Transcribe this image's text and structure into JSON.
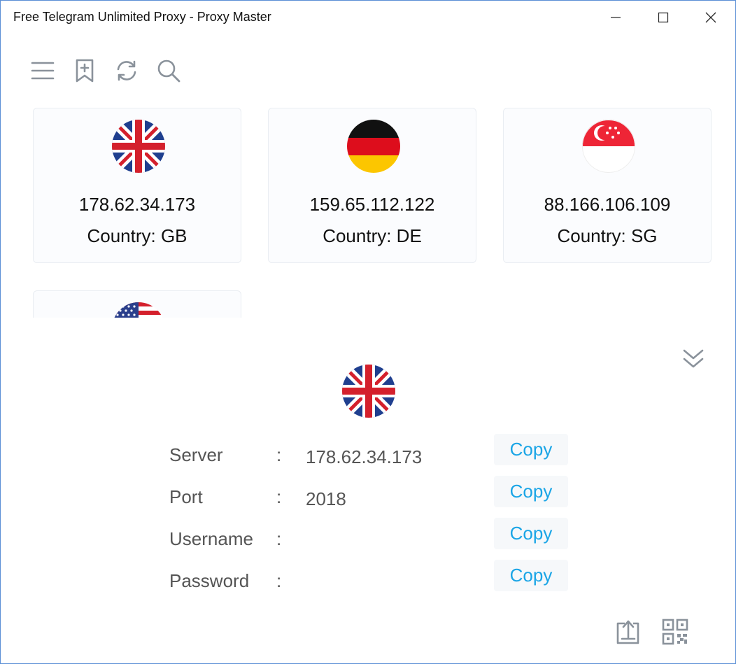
{
  "window": {
    "title": "Free Telegram Unlimited Proxy - Proxy Master"
  },
  "toolbar": {
    "icons": [
      "menu-icon",
      "bookmark-add-icon",
      "refresh-icon",
      "search-icon"
    ]
  },
  "proxies": [
    {
      "ip": "178.62.34.173",
      "country": "Country: GB",
      "flag": "gb-flag-icon"
    },
    {
      "ip": "159.65.112.122",
      "country": "Country: DE",
      "flag": "de-flag-icon"
    },
    {
      "ip": "88.166.106.109",
      "country": "Country: SG",
      "flag": "sg-flag-icon"
    },
    {
      "ip": "",
      "country": "",
      "flag": "us-flag-icon"
    }
  ],
  "detail": {
    "flag": "gb-flag-icon",
    "rows": [
      {
        "label": "Server",
        "colon": ":",
        "value": "178.62.34.173",
        "copy": "Copy"
      },
      {
        "label": "Port",
        "colon": ":",
        "value": "2018",
        "copy": "Copy"
      },
      {
        "label": "Username",
        "colon": ":",
        "value": "",
        "copy": "Copy"
      },
      {
        "label": "Password",
        "colon": ":",
        "value": "",
        "copy": "Copy"
      }
    ]
  },
  "bottom_actions": [
    "share-export-icon",
    "qr-code-icon"
  ],
  "colors": {
    "accent": "#1aa5e6",
    "icon_gray": "#8a929b",
    "card_bg": "#fbfcfe",
    "window_border": "#5a8fd6"
  }
}
